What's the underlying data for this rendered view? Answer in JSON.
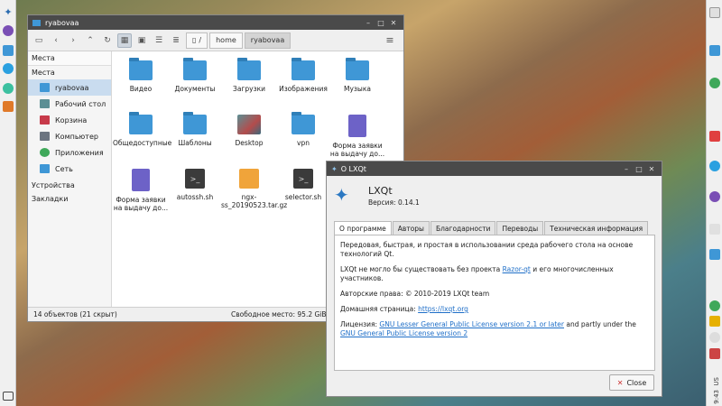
{
  "file_manager": {
    "title": "ryabovaa",
    "breadcrumb": [
      "/",
      "home",
      "ryabovaa"
    ],
    "sidebar": {
      "places_header": "Места",
      "places_section": "Места",
      "items": [
        {
          "label": "ryabovaa",
          "color": "#3f97d6"
        },
        {
          "label": "Рабочий стол",
          "color": "#5c8f94"
        },
        {
          "label": "Корзина",
          "color": "#c73a4a"
        },
        {
          "label": "Компьютер",
          "color": "#6b7480"
        },
        {
          "label": "Приложения",
          "color": "#3fa85a"
        },
        {
          "label": "Сеть",
          "color": "#3f97d6"
        }
      ],
      "devices": "Устройства",
      "bookmarks": "Закладки"
    },
    "files": [
      {
        "name": "Видео",
        "icon": "folder-video-icon"
      },
      {
        "name": "Документы",
        "icon": "folder-documents-icon"
      },
      {
        "name": "Загрузки",
        "icon": "folder-download-icon"
      },
      {
        "name": "Изображения",
        "icon": "folder-pictures-icon"
      },
      {
        "name": "Музыка",
        "icon": "folder-music-icon"
      },
      {
        "name": "Общедоступные",
        "icon": "folder-public-icon"
      },
      {
        "name": "Шаблоны",
        "icon": "folder-templates-icon"
      },
      {
        "name": "Desktop",
        "icon": "desktop-icon"
      },
      {
        "name": "vpn",
        "icon": "folder-icon"
      },
      {
        "name": "Форма заявки на выдачу до...",
        "icon": "document-icon"
      },
      {
        "name": "Форма заявки на выдачу до...",
        "icon": "document-icon"
      },
      {
        "name": "autossh.sh",
        "icon": "script-icon"
      },
      {
        "name": "ngx-ss_20190523.tar.gz",
        "icon": "archive-icon"
      },
      {
        "name": "selector.sh",
        "icon": "script-icon"
      }
    ],
    "status_left": "14 объектов (21 скрыт)",
    "status_right": "Свободное место: 95.2 GiB"
  },
  "about": {
    "title": "О LXQt",
    "app_name": "LXQt",
    "version": "Версия: 0.14.1",
    "tabs": [
      "О программе",
      "Авторы",
      "Благодарности",
      "Переводы",
      "Техническая информация"
    ],
    "p1": "Передовая, быстрая, и простая в использовании среда рабочего стола на основе технологий Qt.",
    "p2_a": "LXQt не могло бы существовать без проекта ",
    "p2_link": "Razor-qt",
    "p2_b": " и его многочисленных участников.",
    "p3": "Авторские права: © 2010-2019 LXQt team",
    "p4_a": "Домашняя страница: ",
    "p4_link": "https://lxqt.org",
    "p5_a": "Лицензия: ",
    "p5_link1": "GNU Lesser General Public License version 2.1 or later",
    "p5_b": " and partly under the ",
    "p5_link2": "GNU General Public License version 2",
    "close": "Close"
  },
  "tray": {
    "keyboard": "US",
    "clock": "9:43"
  }
}
